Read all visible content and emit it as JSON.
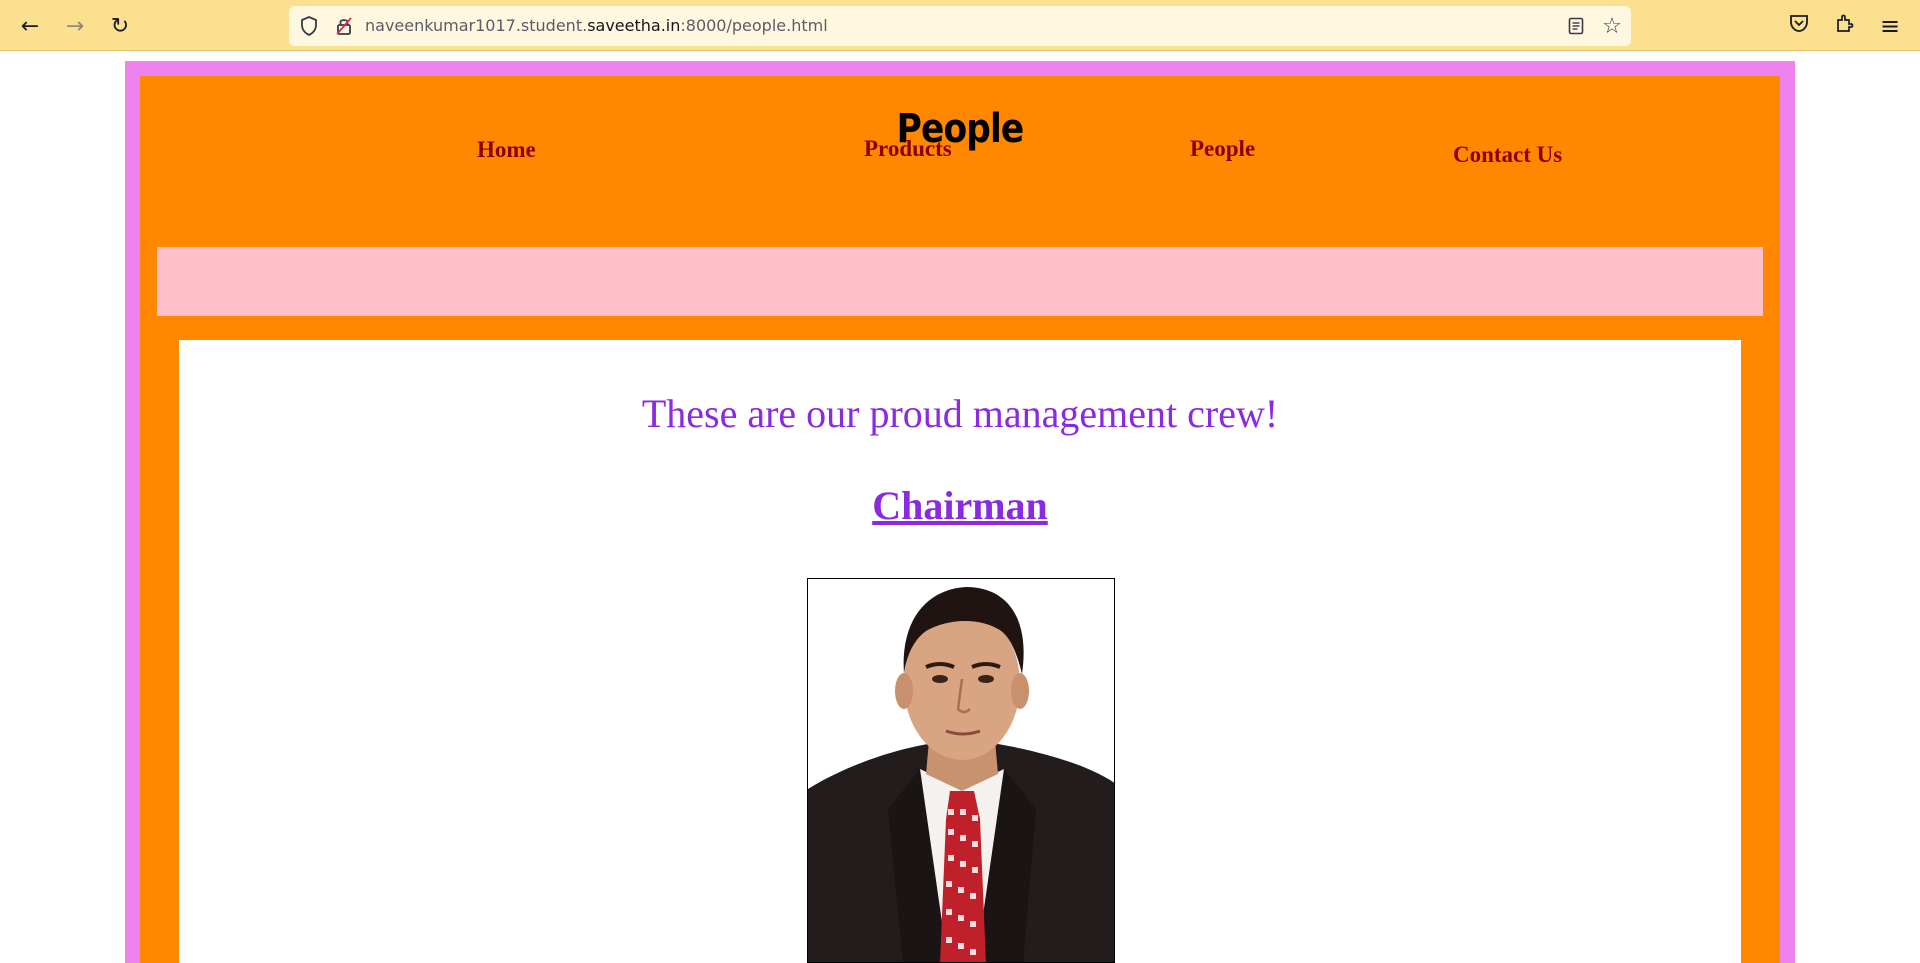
{
  "browser": {
    "url_prefix": "naveenkumar1017.student.",
    "url_host": "saveetha.in",
    "url_suffix": ":8000/people.html",
    "icons": {
      "back": "←",
      "forward": "→",
      "reload": "↻",
      "shield": "shield-icon",
      "permissions": "lock-icon",
      "reader": "reader-view-icon",
      "bookmark": "☆",
      "pocket": "pocket-icon",
      "extensions": "extensions-icon",
      "menu": "≡"
    }
  },
  "nav": {
    "home": "Home",
    "products": "Products",
    "people": "People",
    "contact": "Contact Us"
  },
  "banner": {
    "title": "People"
  },
  "content": {
    "intro": "These are our proud management crew!",
    "role": "Chairman"
  },
  "colors": {
    "chrome": "#fbe08f",
    "outer_border": "#ee82ee",
    "page_background": "#ff8800",
    "nav_text": "#8b0000",
    "banner": "#ffc0cb",
    "content_text": "#8a2be2"
  }
}
